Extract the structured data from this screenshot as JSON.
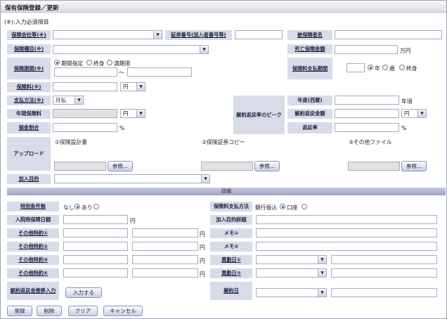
{
  "title": "保有保険登録／更新",
  "note": "(※):入力必須項目",
  "labels": {
    "company": "保険会社等(※)",
    "policy_no": "証券番号(加入者番号等)",
    "insured": "被保険者名",
    "type": "保険種目(※)",
    "death_amount": "死亡保険金額",
    "period": "保険期間(※)",
    "pay_period": "保険料支払期間",
    "premium": "保険料(※)",
    "pay_method": "支払方法(※)",
    "peak": "解約返戻率のピーク",
    "year": "年度(西暦)",
    "annual_premium": "年間保険料",
    "surrender_amount": "解約返戻金額",
    "loss_ratio": "損金割合",
    "return_rate": "返戻率",
    "upload": "アップロード",
    "purpose": "加入目的",
    "special": "特別条件無",
    "pay_way": "保険料支払方法",
    "hosp_daily": "入院時保障日額",
    "purpose_detail": "加入目的詳細",
    "other1": "その他特約①",
    "other2": "その他特約②",
    "other3": "その他特約③",
    "other4": "その他特約④",
    "memo1": "メモ①",
    "memo2": "メモ②",
    "change1": "異動日①",
    "change2": "異動日②",
    "surrender_input": "解約返戻金推移入力",
    "cancel_date": "解約日"
  },
  "units": {
    "man_yen": "万円",
    "percent": "%",
    "year_suffix": "年頃",
    "yen": "円",
    "tilde": "〜"
  },
  "selects": {
    "premium_unit": "円",
    "pay_method": "月払",
    "annual_unit": "円",
    "surrender_unit": "円"
  },
  "period_options": [
    "期間指定",
    "終身",
    "満期限"
  ],
  "pay_period_options": [
    "年",
    "歳",
    "終身"
  ],
  "special_options": [
    "なし",
    "あり"
  ],
  "pay_way_options": [
    "銀行振込",
    "口座"
  ],
  "upload": {
    "item1": "①保険設計書",
    "item2": "②保険証券コピー",
    "item3": "③その他ファイル",
    "browse": "参照..."
  },
  "section_title": "詳細",
  "buttons": {
    "input": "入力する",
    "register": "登録",
    "delete": "削除",
    "clear": "クリア",
    "cancel": "キャンセル"
  },
  "colors": {
    "label_bg": "#d8dbe8",
    "section_bar": "#9da2c7",
    "accent": "#2a58b8"
  }
}
